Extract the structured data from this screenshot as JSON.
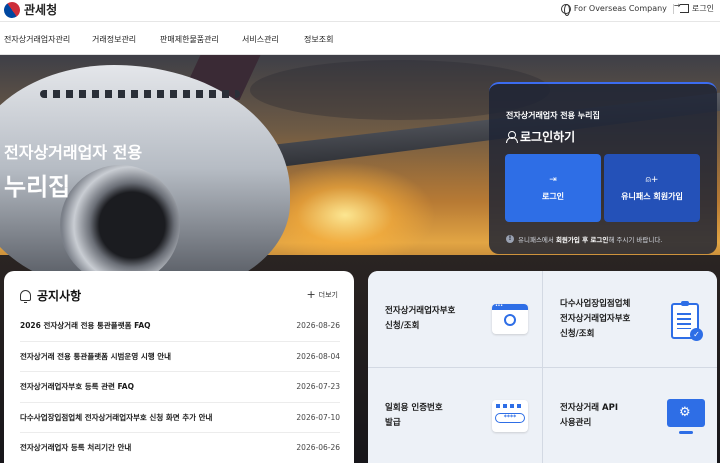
{
  "header": {
    "logo_text": "관세청",
    "overseas_label": "For Overseas Company",
    "login_label": "로그인"
  },
  "nav": {
    "items": [
      "전자상거래업자관리",
      "거래정보관리",
      "판매제한물품관리",
      "서비스관리",
      "정보조회"
    ]
  },
  "hero": {
    "title_line1": "전자상거래업자 전용",
    "title_line2": "누리집"
  },
  "login_panel": {
    "subtitle": "전자상거래업자 전용 누리집",
    "heading": "로그인하기",
    "login_button": "로그인",
    "join_button": "유니패스 회원가입",
    "note_prefix": "유니패스에서 ",
    "note_bold": "회원가입 후 로그인",
    "note_suffix": "해 주시기 바랍니다."
  },
  "notice": {
    "title": "공지사항",
    "more_label": "더보기",
    "items": [
      {
        "title": "2026 전자상거래 전용 통관플랫폼 FAQ",
        "date": "2026-08-26"
      },
      {
        "title": "전자상거래 전용 통관플랫폼 시범운영 시행 안내",
        "date": "2026-08-04"
      },
      {
        "title": "전자상거래업자부호 등록 관련 FAQ",
        "date": "2026-07-23"
      },
      {
        "title": "다수사업장입점업체 전자상거래업자부호 신청 화면 추가 안내",
        "date": "2026-07-10"
      },
      {
        "title": "전자상거래업자 등록 처리기간 안내",
        "date": "2026-06-26"
      }
    ]
  },
  "services": [
    {
      "label": "전자상거래업자부호\n신청/조회",
      "icon": "search-window-icon"
    },
    {
      "label": "다수사업장입점업체\n전자상거래업자부호\n신청/조회",
      "icon": "clipboard-check-icon"
    },
    {
      "label": "일회용 인증번호\n발급",
      "icon": "password-icon",
      "code_text": "****"
    },
    {
      "label": "전자상거래 API\n사용관리",
      "icon": "monitor-gear-icon"
    }
  ],
  "colors": {
    "accent": "#2e6ee6",
    "panel": "#1e2434"
  }
}
